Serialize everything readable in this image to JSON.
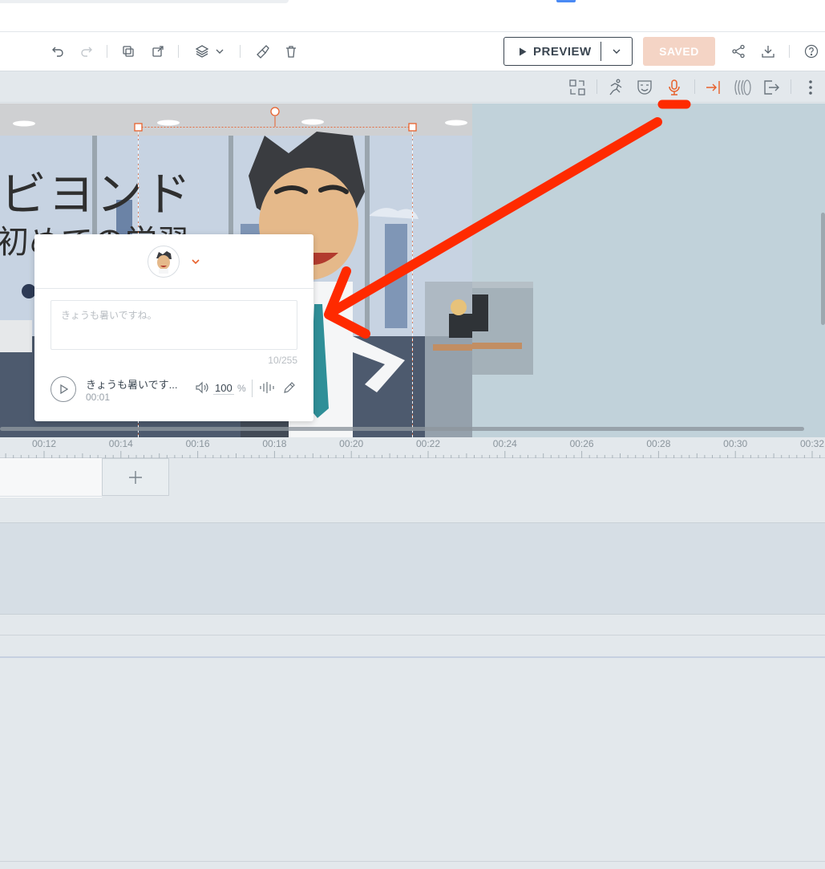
{
  "toolbar": {
    "preview_label": "PREVIEW",
    "saved_label": "SAVED"
  },
  "scene": {
    "title_line1": "ビヨンド",
    "title_line2": "初めての学習"
  },
  "speech_popup": {
    "placeholder": "きょうも暑いですね。",
    "char_count": "10/255",
    "audio_title": "きょうも暑いです...",
    "audio_time": "00:01",
    "volume": "100",
    "volume_unit": "%"
  },
  "timeline": {
    "labels": [
      "00:12",
      "00:14",
      "00:16",
      "00:18",
      "00:20",
      "00:22",
      "00:24",
      "00:26",
      "00:28",
      "00:30",
      "00:32"
    ]
  },
  "colors": {
    "accent": "#e8612c",
    "saved_bg": "#f4d4c5",
    "annotation_arrow": "#ff2a00"
  },
  "icons": {
    "toolbar": [
      "undo-icon",
      "redo-icon",
      "duplicate-icon",
      "copy-to-icon",
      "layers-icon",
      "chevron-down-icon",
      "brush-icon",
      "trash-icon",
      "share-icon",
      "download-icon",
      "help-icon"
    ],
    "subbar": [
      "swap-icon",
      "action-icon",
      "expression-icon",
      "microphone-icon",
      "enter-icon",
      "motion-icon",
      "exit-icon",
      "more-icon"
    ]
  }
}
